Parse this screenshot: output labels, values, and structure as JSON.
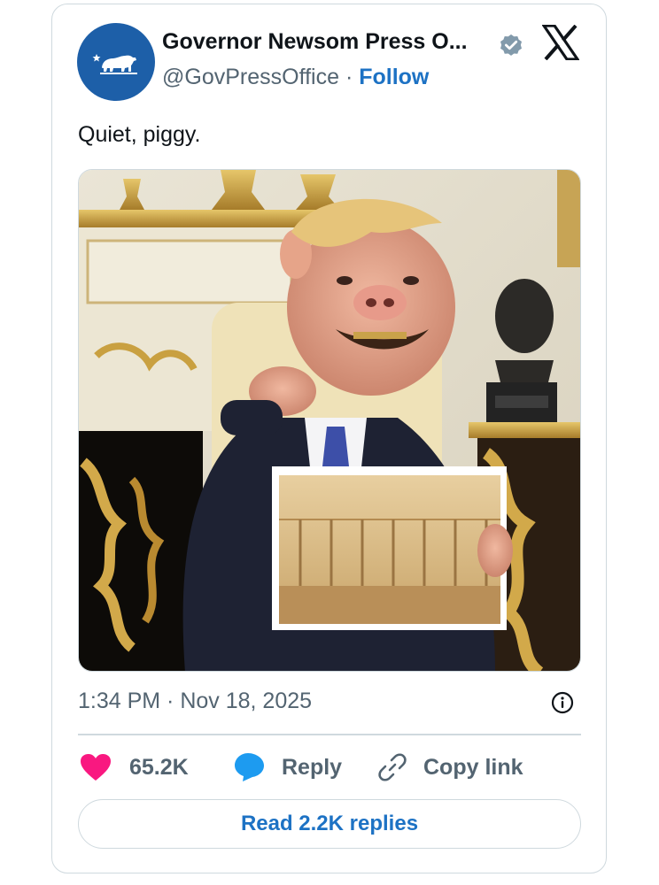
{
  "tweet": {
    "author": {
      "display_name": "Governor Newsom Press O...",
      "handle": "@GovPressOffice",
      "separator": "·",
      "follow_label": "Follow",
      "avatar_icon": "california-bear-icon",
      "verified_icon": "verified-badge-icon"
    },
    "platform_icon": "x-logo-icon",
    "text": "Quiet, piggy.",
    "media": {
      "icon": "image-photo"
    },
    "timestamp": "1:34 PM · Nov 18, 2025",
    "info_icon": "info-icon",
    "actions": {
      "likes_count": "65.2K",
      "reply_label": "Reply",
      "copy_link_label": "Copy link"
    },
    "read_replies_label": "Read 2.2K replies"
  },
  "colors": {
    "like": "#f91880",
    "reply": "#1d9bf0",
    "link_blue": "#1d72c4",
    "avatar_bg": "#1d5fa8",
    "muted": "#536471",
    "border": "#cfd9de"
  }
}
